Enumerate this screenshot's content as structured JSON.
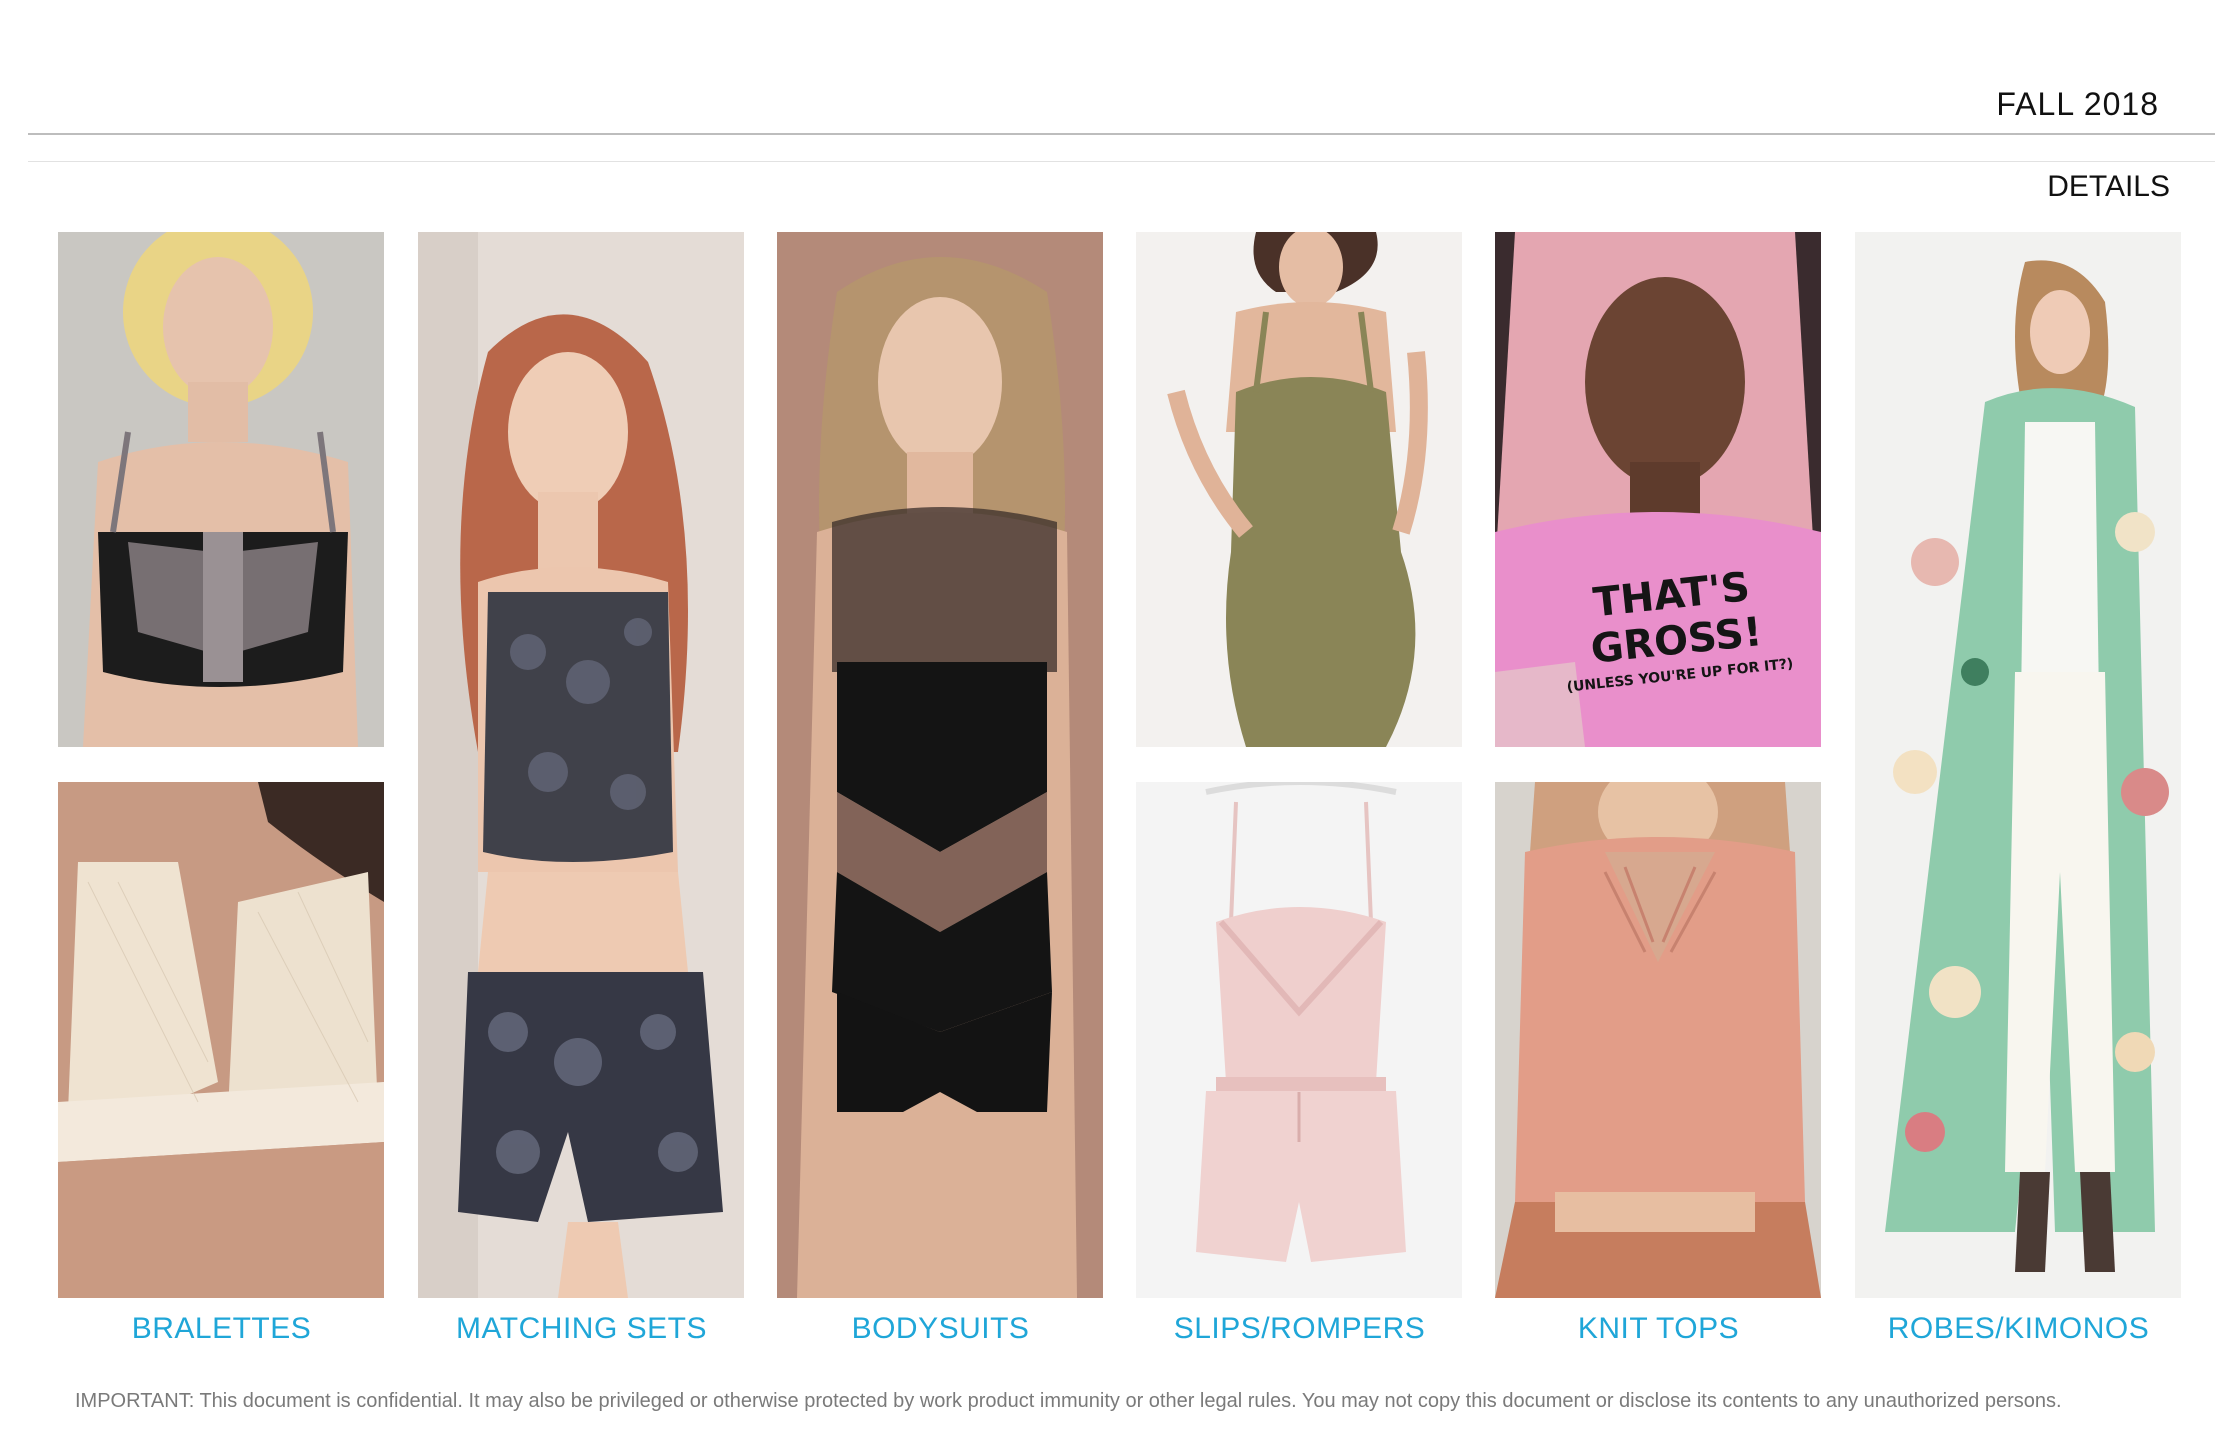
{
  "header": {
    "season": "FALL 2018",
    "section": "DETAILS"
  },
  "images": {
    "bralette_top": "black sheer bralette",
    "bralette_lace": "cream lace halter bralette",
    "matching_set": "printed velvet crop top and shorts",
    "bodysuit": "black mesh chevron bodysuit",
    "slip_dress": "olive strappy slip dress",
    "romper": "pink satin romper",
    "tee": "pink graphic tee",
    "knit_top": "coral ribbed knit crop top",
    "kimono": "green floral print kimono robe"
  },
  "tee_text": {
    "line1": "THAT'S GROSS!",
    "line2": "(UNLESS YOU'RE UP FOR IT?)"
  },
  "categories": [
    "BRALETTES",
    "MATCHING SETS",
    "BODYSUITS",
    "SLIPS/ROMPERS",
    "KNIT TOPS",
    "ROBES/KIMONOS"
  ],
  "footer": "IMPORTANT: This document is confidential. It may also be privileged or otherwise protected by work product immunity or other legal rules. You may not copy this document or disclose its contents to any unauthorized persons.",
  "colors": {
    "accent": "#1fa6d8",
    "rule": "#bdbdbd"
  }
}
